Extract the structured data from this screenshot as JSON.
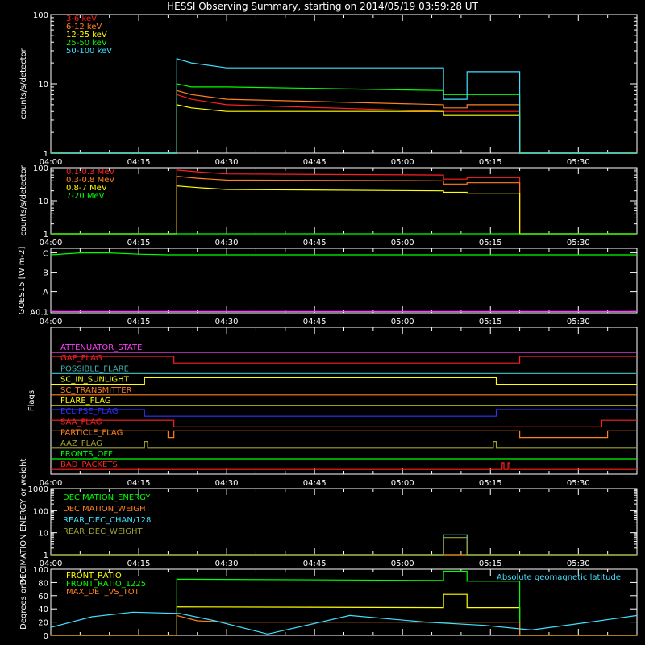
{
  "title": "HESSI Observing Summary, starting on 2014/05/19 03:59:28 UT",
  "colors": {
    "red": "#ff2020",
    "orange": "#ff8020",
    "yellow": "#ffff00",
    "green": "#00ff00",
    "cyan": "#40e0ff",
    "magenta": "#ff40ff",
    "blue": "#3030ff",
    "olive": "#a0a030",
    "white": "#ffffff",
    "teal": "#40b0b0"
  },
  "time_axis": {
    "range": [
      "04:00",
      "05:40"
    ],
    "ticks": [
      "04:00",
      "04:15",
      "04:30",
      "04:45",
      "05:00",
      "05:15",
      "05:30"
    ]
  },
  "chart_data": [
    {
      "id": "panel1",
      "type": "line",
      "ylabel": "counts/s/detector",
      "yscale": "log",
      "ylim": [
        1,
        100
      ],
      "yticklabels": [
        "1",
        "10",
        "100"
      ],
      "series": [
        {
          "name": "3-6 keV",
          "color": "red",
          "t": [
            "04:00",
            "04:21.5",
            "04:21.5",
            "04:24",
            "04:30",
            "05:07",
            "05:07",
            "05:11",
            "05:11",
            "05:20",
            "05:20",
            "05:40"
          ],
          "v": [
            1,
            1,
            7,
            6,
            5,
            4,
            4,
            4,
            4,
            4,
            1,
            1
          ]
        },
        {
          "name": "6-12 keV",
          "color": "orange",
          "t": [
            "04:00",
            "04:21.5",
            "04:21.5",
            "04:24",
            "04:30",
            "05:07",
            "05:07",
            "05:11",
            "05:11",
            "05:20",
            "05:20",
            "05:40"
          ],
          "v": [
            1,
            1,
            8,
            7,
            6,
            5,
            4.5,
            4.5,
            5,
            5,
            1,
            1
          ]
        },
        {
          "name": "12-25 keV",
          "color": "yellow",
          "t": [
            "04:00",
            "04:21.5",
            "04:21.5",
            "04:24",
            "04:30",
            "05:07",
            "05:07",
            "05:11",
            "05:11",
            "05:20",
            "05:20",
            "05:40"
          ],
          "v": [
            1,
            1,
            5,
            4.5,
            4,
            4,
            3.5,
            3.5,
            3.5,
            3.5,
            1,
            1
          ]
        },
        {
          "name": "25-50 keV",
          "color": "green",
          "t": [
            "04:00",
            "04:21.5",
            "04:21.5",
            "04:24",
            "04:30",
            "05:07",
            "05:07",
            "05:11",
            "05:11",
            "05:20",
            "05:20",
            "05:40"
          ],
          "v": [
            1,
            1,
            10,
            9,
            9,
            8,
            7,
            7,
            7,
            7,
            1,
            1
          ]
        },
        {
          "name": "50-100 keV",
          "color": "cyan",
          "t": [
            "04:00",
            "04:21.5",
            "04:21.5",
            "04:24",
            "04:30",
            "05:07",
            "05:07",
            "05:11",
            "05:11",
            "05:20",
            "05:20",
            "05:40"
          ],
          "v": [
            1,
            1,
            23,
            20,
            17,
            17,
            6,
            6,
            15,
            15,
            1,
            1
          ]
        }
      ]
    },
    {
      "id": "panel2",
      "type": "line",
      "ylabel": "counts/s/detector",
      "yscale": "log",
      "ylim": [
        1,
        100
      ],
      "yticklabels": [
        "1",
        "10",
        "100"
      ],
      "series": [
        {
          "name": "0.1-0.3 MeV",
          "color": "red",
          "t": [
            "04:00",
            "04:21.5",
            "04:21.5",
            "04:25",
            "04:30",
            "05:07",
            "05:07",
            "05:11",
            "05:11",
            "05:20",
            "05:20",
            "05:40"
          ],
          "v": [
            1,
            1,
            85,
            75,
            65,
            60,
            45,
            45,
            50,
            50,
            1,
            1
          ]
        },
        {
          "name": "0.3-0.8 MeV",
          "color": "orange",
          "t": [
            "04:00",
            "04:21.5",
            "04:21.5",
            "04:25",
            "04:30",
            "05:07",
            "05:07",
            "05:11",
            "05:11",
            "05:20",
            "05:20",
            "05:40"
          ],
          "v": [
            1,
            1,
            55,
            48,
            42,
            40,
            32,
            32,
            35,
            35,
            1,
            1
          ]
        },
        {
          "name": "0.8-7 MeV",
          "color": "yellow",
          "t": [
            "04:00",
            "04:21.5",
            "04:21.5",
            "04:25",
            "04:30",
            "05:07",
            "05:07",
            "05:11",
            "05:11",
            "05:20",
            "05:20",
            "05:40"
          ],
          "v": [
            1,
            1,
            28,
            25,
            22,
            20,
            18,
            18,
            17,
            17,
            1,
            1
          ]
        },
        {
          "name": "7-20 MeV",
          "color": "green",
          "t": [
            "04:00",
            "05:40"
          ],
          "v": [
            1,
            1
          ]
        }
      ]
    },
    {
      "id": "panel3",
      "type": "line",
      "ylabel": "GOES15 [W m-2]",
      "yticklabels": [
        "A0.1",
        "A",
        "B",
        "C"
      ],
      "series": [
        {
          "color": "green",
          "t": [
            "04:00",
            "04:05",
            "04:10",
            "04:15",
            "04:20",
            "05:40"
          ],
          "v": [
            0.9,
            0.93,
            0.93,
            0.91,
            0.9,
            0.9
          ]
        },
        {
          "color": "magenta",
          "t": [
            "04:00",
            "05:40"
          ],
          "v": [
            0.02,
            0.02
          ]
        }
      ]
    },
    {
      "id": "panel4",
      "type": "line",
      "ylabel": "Flags",
      "flags": [
        {
          "name": "ATTENUATOR_STATE",
          "color": "magenta",
          "t": [
            "04:00",
            "05:40"
          ],
          "v": [
            0,
            0
          ]
        },
        {
          "name": "GAP_FLAG",
          "color": "red",
          "t": [
            "04:00",
            "04:21",
            "04:21",
            "05:20",
            "05:20",
            "05:40"
          ],
          "v": [
            1,
            1,
            0,
            0,
            1,
            1
          ]
        },
        {
          "name": "POSSIBLE_FLARE",
          "color": "teal",
          "t": [
            "04:00",
            "05:40"
          ],
          "v": [
            0,
            0
          ]
        },
        {
          "name": "SC_IN_SUNLIGHT",
          "color": "yellow",
          "t": [
            "04:00",
            "04:16",
            "04:16",
            "05:16",
            "05:16",
            "05:40"
          ],
          "v": [
            0,
            0,
            1,
            1,
            0,
            0
          ]
        },
        {
          "name": "SC_TRANSMITTER",
          "color": "orange",
          "t": [
            "04:00",
            "05:40"
          ],
          "v": [
            0,
            0
          ]
        },
        {
          "name": "FLARE_FLAG",
          "color": "yellow",
          "t": [
            "04:00",
            "05:40"
          ],
          "v": [
            0,
            0
          ]
        },
        {
          "name": "ECLIPSE_FLAG",
          "color": "blue",
          "t": [
            "04:00",
            "04:16",
            "04:16",
            "05:16",
            "05:16",
            "05:40"
          ],
          "v": [
            1,
            1,
            0,
            0,
            1,
            1
          ]
        },
        {
          "name": "SAA_FLAG",
          "color": "red",
          "t": [
            "04:00",
            "04:21",
            "04:21",
            "05:34",
            "05:34",
            "05:40"
          ],
          "v": [
            1,
            1,
            0,
            0,
            1,
            1
          ]
        },
        {
          "name": "PARTICLE_FLAG",
          "color": "orange",
          "t": [
            "04:00",
            "04:20",
            "04:20",
            "04:21",
            "04:21",
            "05:20",
            "05:20",
            "05:35",
            "05:35",
            "05:40"
          ],
          "v": [
            1,
            1,
            0,
            0,
            1,
            1,
            0,
            0,
            1,
            1
          ]
        },
        {
          "name": "AAZ_FLAG",
          "color": "olive",
          "t": [
            "04:00",
            "04:16",
            "04:16",
            "04:16.5",
            "04:16.5",
            "05:15.5",
            "05:15.5",
            "05:16",
            "05:16",
            "05:40"
          ],
          "v": [
            0,
            0,
            1,
            1,
            0,
            0,
            1,
            1,
            0,
            0
          ]
        },
        {
          "name": "FRONTS_OFF",
          "color": "green",
          "t": [
            "04:00",
            "05:40"
          ],
          "v": [
            0,
            0
          ]
        },
        {
          "name": "BAD_PACKETS",
          "color": "red",
          "t": [
            "04:00",
            "05:17",
            "05:17",
            "05:17.3",
            "05:17.3",
            "05:18",
            "05:18",
            "05:18.3",
            "05:18.3",
            "05:40"
          ],
          "v": [
            0,
            0,
            1,
            1,
            0,
            0,
            1,
            1,
            0,
            0
          ]
        }
      ]
    },
    {
      "id": "panel5",
      "type": "line",
      "ylabel": "DECIMATION ENERGY or weight",
      "yscale": "log",
      "ylim": [
        1,
        1000
      ],
      "yticklabels": [
        "1",
        "10",
        "100",
        "1000"
      ],
      "series": [
        {
          "name": "DECIMATION_ENERGY",
          "color": "green",
          "t": [
            "04:00",
            "05:40"
          ],
          "v": [
            1,
            1
          ]
        },
        {
          "name": "DECIMATION_WEIGHT",
          "color": "orange",
          "t": [
            "04:00",
            "05:40"
          ],
          "v": [
            1,
            1
          ]
        },
        {
          "name": "REAR_DEC_CHAN/128",
          "color": "cyan",
          "t": [
            "04:00",
            "05:07",
            "05:07",
            "05:11",
            "05:11",
            "05:40"
          ],
          "v": [
            1,
            1,
            8,
            8,
            1,
            1
          ]
        },
        {
          "name": "REAR_DEC_WEIGHT",
          "color": "olive",
          "t": [
            "04:00",
            "05:07",
            "05:07",
            "05:11",
            "05:11",
            "05:40"
          ],
          "v": [
            1,
            1,
            6,
            6,
            1,
            1
          ]
        }
      ]
    },
    {
      "id": "panel6",
      "type": "line",
      "ylabel": "Degrees or %",
      "ylim": [
        0,
        100
      ],
      "yticklabels": [
        "0",
        "20",
        "40",
        "60",
        "80",
        "100"
      ],
      "annotation": "Absolute geomagnetic latitude",
      "series": [
        {
          "name": "FRONT_RATIO",
          "color": "yellow",
          "t": [
            "04:00",
            "04:21.5",
            "04:21.5",
            "05:07",
            "05:07",
            "05:11",
            "05:11",
            "05:20",
            "05:20",
            "05:40"
          ],
          "v": [
            0,
            0,
            43,
            42,
            62,
            62,
            42,
            42,
            0,
            0
          ]
        },
        {
          "name": "FRONT_RATIO_1225",
          "color": "green",
          "t": [
            "04:00",
            "04:21.5",
            "04:21.5",
            "05:07",
            "05:07",
            "05:11",
            "05:11",
            "05:20",
            "05:20",
            "05:40"
          ],
          "v": [
            0,
            0,
            85,
            83,
            97,
            97,
            82,
            82,
            0,
            0
          ]
        },
        {
          "name": "MAX_DET_VS_TOT",
          "color": "orange",
          "t": [
            "04:00",
            "04:21.5",
            "04:21.5",
            "04:25",
            "04:30",
            "05:20",
            "05:20",
            "05:40"
          ],
          "v": [
            0,
            0,
            30,
            22,
            20,
            20,
            0,
            0
          ]
        },
        {
          "color": "cyan",
          "t": [
            "04:00",
            "04:07",
            "04:14",
            "04:22",
            "04:28",
            "04:37",
            "04:51",
            "05:04",
            "05:14",
            "05:22",
            "05:32",
            "05:40"
          ],
          "v": [
            12,
            28,
            35,
            33,
            22,
            2,
            30,
            20,
            15,
            8,
            20,
            30
          ]
        }
      ]
    }
  ]
}
